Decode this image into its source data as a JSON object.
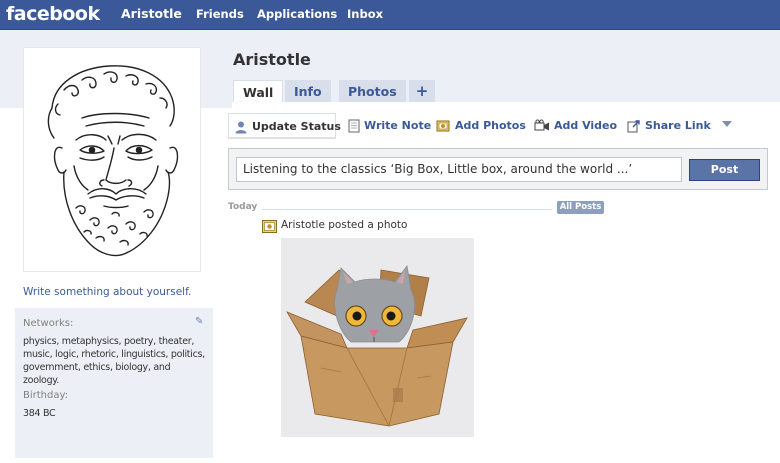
{
  "topbar": {
    "logo": "facebook",
    "nav": {
      "profile": "Aristotle",
      "friends": "Friends",
      "applications": "Applications",
      "inbox": "Inbox"
    }
  },
  "sidebar": {
    "write_about": "Write something about yourself.",
    "networks_label": "Networks:",
    "networks_value": "physics, metaphysics, poetry, theater, music, logic, rhetoric, linguistics, politics, government, ethics, biology, and zoology.",
    "birthday_label": "Birthday:",
    "birthday_value": "384 BC"
  },
  "profile": {
    "name": "Aristotle"
  },
  "tabs": [
    {
      "label": "Wall"
    },
    {
      "label": "Info"
    },
    {
      "label": "Photos"
    },
    {
      "label": "+"
    }
  ],
  "actions": {
    "update_status": "Update Status",
    "write_note": "Write Note",
    "add_photos": "Add Photos",
    "add_video": "Add Video",
    "share_link": "Share Link"
  },
  "composer": {
    "value": "Listening to the classics ‘Big Box, Little box, around the world ...’",
    "post_label": "Post"
  },
  "feed": {
    "today_label": "Today",
    "all_posts_label": "All Posts",
    "story": "Aristotle posted a photo"
  },
  "colors": {
    "brand_blue": "#3b5998",
    "tab_bg": "#d8dfea",
    "panel_bg": "#eceff5",
    "post_button": "#5b74a8"
  },
  "icons": {
    "update_status": "person-icon",
    "write_note": "note-icon",
    "add_photos": "photo-icon",
    "add_video": "video-camera-icon",
    "share_link": "share-link-icon",
    "story": "photo-icon",
    "edit": "pencil-icon"
  }
}
